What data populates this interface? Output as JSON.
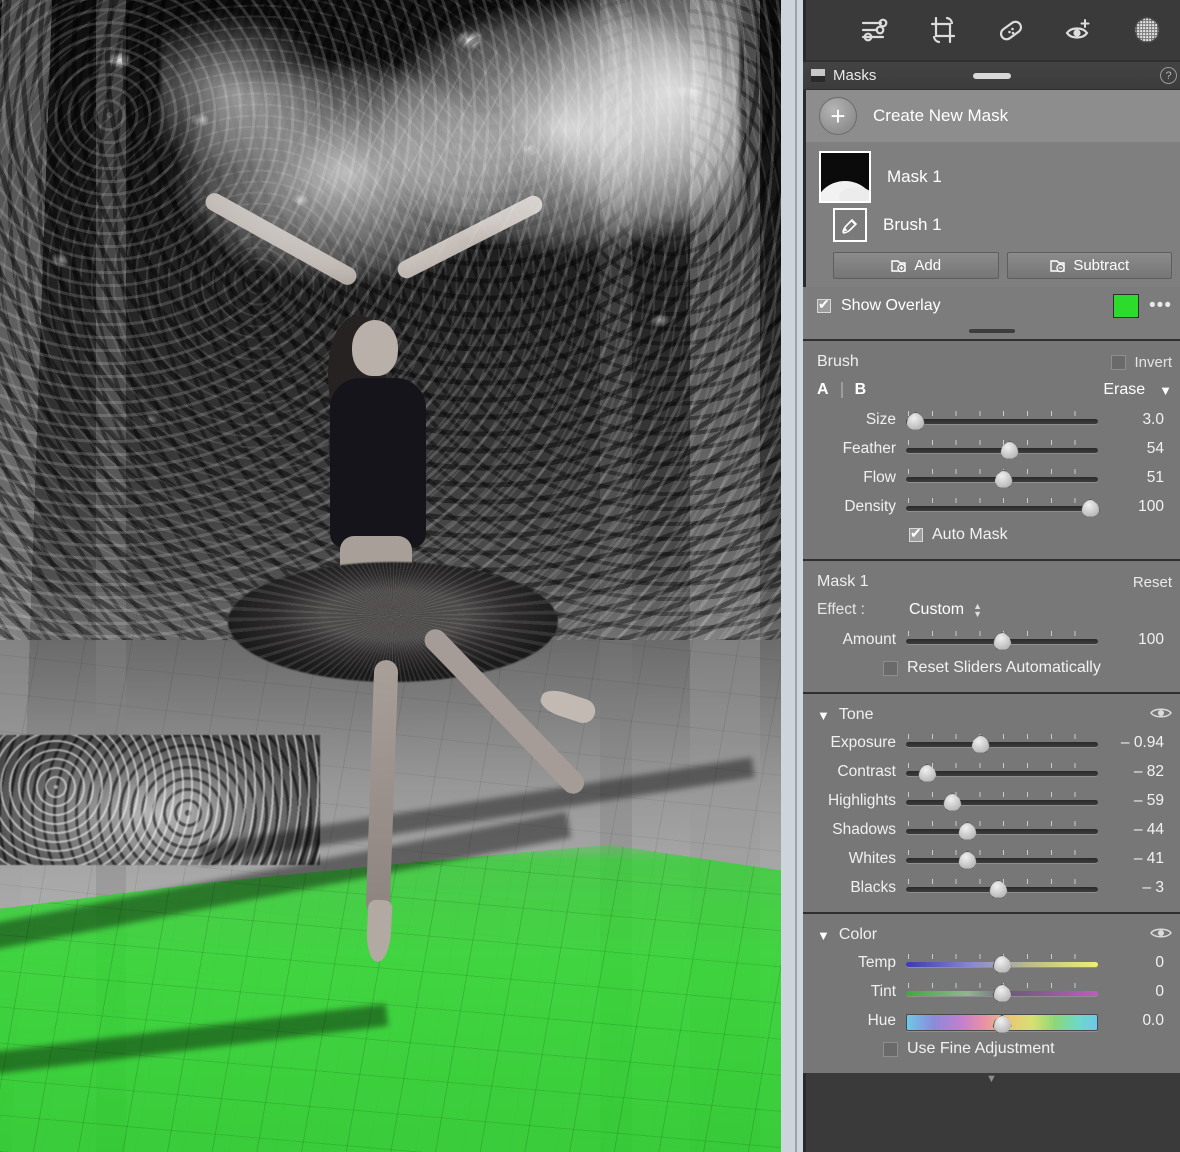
{
  "photo": {
    "description": "Black and white photo of a ballerina en pointe with flowing sheer fabric in a tree-lined park path",
    "overlay_color": "#2ddb2d"
  },
  "toolbar": {
    "icons": [
      {
        "name": "edit-sliders-icon",
        "label": "Edit"
      },
      {
        "name": "crop-icon",
        "label": "Crop"
      },
      {
        "name": "healing-brush-icon",
        "label": "Healing"
      },
      {
        "name": "red-eye-icon",
        "label": "Red Eye"
      },
      {
        "name": "masking-icon",
        "label": "Masking"
      }
    ]
  },
  "masks_header": {
    "title": "Masks",
    "help": "?"
  },
  "masks": {
    "create_label": "Create New Mask",
    "items": [
      {
        "name": "Mask 1",
        "sub": "Brush 1"
      }
    ],
    "add_label": "Add",
    "subtract_label": "Subtract",
    "show_overlay_label": "Show Overlay",
    "show_overlay_checked": true,
    "overlay_swatch": "#2ddb2d",
    "more_dots": "•••"
  },
  "brush": {
    "title": "Brush",
    "invert_label": "Invert",
    "invert_checked": false,
    "a_label": "A",
    "b_label": "B",
    "erase_label": "Erase",
    "sliders": [
      {
        "label": "Size",
        "value": "3.0",
        "pos": 5
      },
      {
        "label": "Feather",
        "value": "54",
        "pos": 54
      },
      {
        "label": "Flow",
        "value": "51",
        "pos": 51
      },
      {
        "label": "Density",
        "value": "100",
        "pos": 96
      }
    ],
    "auto_mask_label": "Auto Mask",
    "auto_mask_checked": true
  },
  "mask_effect": {
    "title": "Mask 1",
    "reset_label": "Reset",
    "effect_label": "Effect :",
    "effect_value": "Custom",
    "amount": {
      "label": "Amount",
      "value": "100",
      "pos": 50
    },
    "reset_sliders_label": "Reset Sliders Automatically",
    "reset_sliders_checked": false
  },
  "tone": {
    "title": "Tone",
    "sliders": [
      {
        "label": "Exposure",
        "value": "– 0.94",
        "pos": 39
      },
      {
        "label": "Contrast",
        "value": "– 82",
        "pos": 11
      },
      {
        "label": "Highlights",
        "value": "– 59",
        "pos": 24
      },
      {
        "label": "Shadows",
        "value": "– 44",
        "pos": 32
      },
      {
        "label": "Whites",
        "value": "– 41",
        "pos": 32
      },
      {
        "label": "Blacks",
        "value": "– 3",
        "pos": 48
      }
    ]
  },
  "color": {
    "title": "Color",
    "sliders": [
      {
        "label": "Temp",
        "value": "0",
        "pos": 50,
        "grad": "grad-temp"
      },
      {
        "label": "Tint",
        "value": "0",
        "pos": 50,
        "grad": "grad-tint"
      },
      {
        "label": "Hue",
        "value": "0.0",
        "pos": 50,
        "grad": "grad-hue"
      }
    ],
    "fine_adjustment_label": "Use Fine Adjustment",
    "fine_adjustment_checked": false
  }
}
